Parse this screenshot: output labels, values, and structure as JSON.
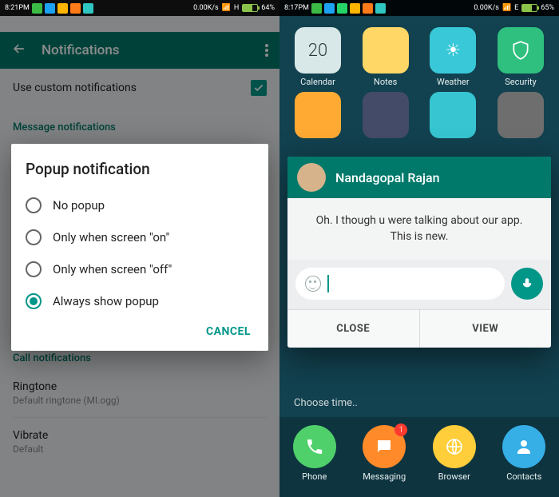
{
  "left": {
    "status": {
      "time": "8:21PM",
      "netspeed": "0.00K/s",
      "net": "H",
      "batt": "64%",
      "batt_pct": 64
    },
    "appbar": {
      "title": "Notifications"
    },
    "settings": {
      "row1": "Use custom notifications",
      "section_msg": "Message notifications",
      "section_call": "Call notifications",
      "ringtone_lbl": "Ringtone",
      "ringtone_sub": "Default ringtone (MI.ogg)",
      "vibrate_lbl": "Vibrate",
      "vibrate_sub": "Default"
    },
    "dialog": {
      "title": "Popup notification",
      "options": [
        "No popup",
        "Only when screen \"on\"",
        "Only when screen \"off\"",
        "Always show popup"
      ],
      "selected": 3,
      "cancel": "CANCEL"
    }
  },
  "right": {
    "status": {
      "time": "8:17PM",
      "netspeed": "0.00K/s",
      "net": "E",
      "batt": "65%",
      "batt_pct": 65
    },
    "home": {
      "row1": [
        {
          "name": "Calendar",
          "glyph": "20"
        },
        {
          "name": "Notes",
          "glyph": ""
        },
        {
          "name": "Weather",
          "glyph": ""
        },
        {
          "name": "Security",
          "glyph": ""
        }
      ],
      "choose_time": "Choose time..",
      "dock": [
        {
          "name": "Phone"
        },
        {
          "name": "Messaging",
          "badge": "1"
        },
        {
          "name": "Browser"
        },
        {
          "name": "Contacts"
        }
      ]
    },
    "popup": {
      "contact": "Nandagopal Rajan",
      "message": "Oh. I though u were talking about our app. This is new.",
      "close": "CLOSE",
      "view": "VIEW"
    }
  }
}
